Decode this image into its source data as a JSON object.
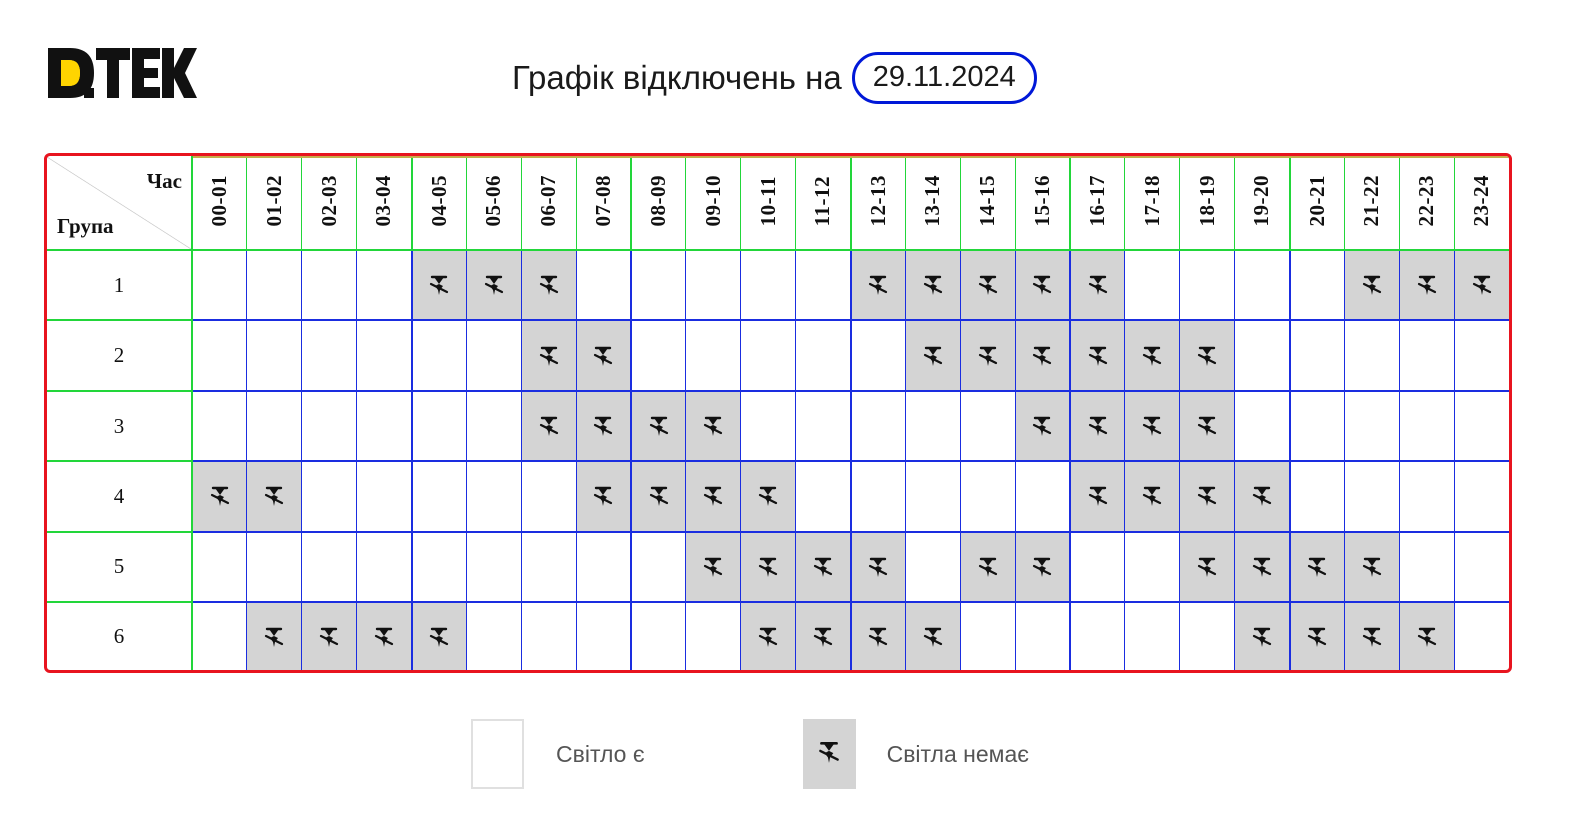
{
  "header": {
    "title": "Графік відключень на",
    "date": "29.11.2024"
  },
  "logo_text": "D.TEK",
  "table": {
    "corner_hour": "Час",
    "corner_group": "Група",
    "hours": [
      "00-01",
      "01-02",
      "02-03",
      "03-04",
      "04-05",
      "05-06",
      "06-07",
      "07-08",
      "08-09",
      "09-10",
      "10-11",
      "11-12",
      "12-13",
      "13-14",
      "14-15",
      "15-16",
      "16-17",
      "17-18",
      "18-19",
      "19-20",
      "20-21",
      "21-22",
      "22-23",
      "23-24"
    ],
    "groups": [
      {
        "label": "1",
        "off": [
          0,
          0,
          0,
          0,
          1,
          1,
          1,
          0,
          0,
          0,
          0,
          0,
          1,
          1,
          1,
          1,
          1,
          0,
          0,
          0,
          0,
          1,
          1,
          1
        ]
      },
      {
        "label": "2",
        "off": [
          0,
          0,
          0,
          0,
          0,
          0,
          1,
          1,
          0,
          0,
          0,
          0,
          0,
          1,
          1,
          1,
          1,
          1,
          1,
          0,
          0,
          0,
          0,
          0
        ]
      },
      {
        "label": "3",
        "off": [
          0,
          0,
          0,
          0,
          0,
          0,
          1,
          1,
          1,
          1,
          0,
          0,
          0,
          0,
          0,
          1,
          1,
          1,
          1,
          0,
          0,
          0,
          0,
          0
        ]
      },
      {
        "label": "4",
        "off": [
          1,
          1,
          0,
          0,
          0,
          0,
          0,
          1,
          1,
          1,
          1,
          0,
          0,
          0,
          0,
          0,
          1,
          1,
          1,
          1,
          0,
          0,
          0,
          0
        ]
      },
      {
        "label": "5",
        "off": [
          0,
          0,
          0,
          0,
          0,
          0,
          0,
          0,
          0,
          1,
          1,
          1,
          1,
          0,
          1,
          1,
          0,
          0,
          1,
          1,
          1,
          1,
          0,
          0
        ]
      },
      {
        "label": "6",
        "off": [
          0,
          1,
          1,
          1,
          1,
          0,
          0,
          0,
          0,
          0,
          1,
          1,
          1,
          1,
          0,
          0,
          0,
          0,
          0,
          1,
          1,
          1,
          1,
          0
        ]
      }
    ]
  },
  "legend": {
    "on_label": "Світло є",
    "off_label": "Світла немає"
  },
  "icons": {
    "no_power": "power-off-icon",
    "logo": "dtek-logo"
  },
  "colors": {
    "outline": "#e8141f",
    "header_grid": "#22d63a",
    "slot_grid": "#1a2de0",
    "date_border": "#0018d8",
    "off_fill": "#d4d4d4",
    "logo_yellow": "#ffd400"
  }
}
